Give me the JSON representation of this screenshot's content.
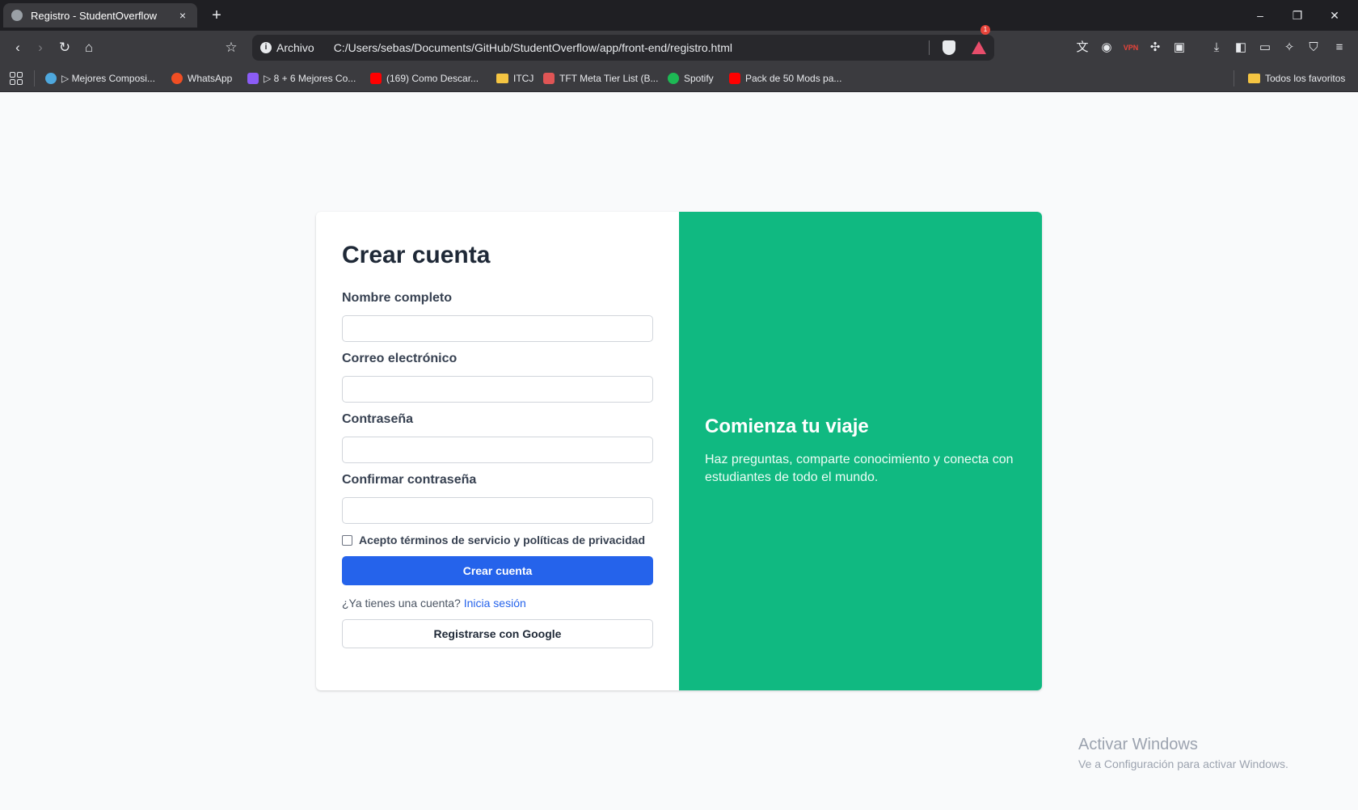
{
  "browser": {
    "tab_title": "Registro - StudentOverflow",
    "tab_close_icon": "×",
    "new_tab_icon": "+",
    "window_controls": {
      "minimize": "–",
      "restore": "❐",
      "close": "✕"
    },
    "address": {
      "label": "Archivo",
      "url": "C:/Users/sebas/Documents/GitHub/StudentOverflow/app/front-end/registro.html",
      "rewards_badge": "1"
    },
    "nav": {
      "back": "‹",
      "forward": "›",
      "reload": "↻",
      "home": "⌂",
      "bookmark": "☆"
    },
    "extensions": [
      "translate-icon",
      "chrome-icon",
      "vpn-icon",
      "puzzle-icon",
      "screenshot-icon",
      "download-icon",
      "sidebar-icon",
      "wallet-icon",
      "leo-icon",
      "vpn-shield-icon",
      "menu-icon"
    ],
    "bookmarks": [
      {
        "label": "▷ Mejores Composi...",
        "color": "#4ea8de"
      },
      {
        "label": "WhatsApp",
        "color": "#f04e23"
      },
      {
        "label": "▷ 8 + 6 Mejores Co...",
        "color": "#8b5cf6"
      },
      {
        "label": "(169) Como Descar...",
        "color": "#ff0000"
      },
      {
        "label": "ITCJ",
        "color": "#f5c542"
      },
      {
        "label": "TFT Meta Tier List (B...",
        "color": "#e05555"
      },
      {
        "label": "Spotify",
        "color": "#1db954"
      },
      {
        "label": "Pack de 50 Mods pa...",
        "color": "#ff0000"
      }
    ],
    "all_bookmarks": "Todos los favoritos"
  },
  "page": {
    "form": {
      "title": "Crear cuenta",
      "name_label": "Nombre completo",
      "email_label": "Correo electrónico",
      "password_label": "Contraseña",
      "confirm_label": "Confirmar contraseña",
      "terms_label": "Acepto términos de servicio y políticas de privacidad",
      "submit_label": "Crear cuenta",
      "login_prompt": "¿Ya tienes una cuenta?",
      "login_link": "Inicia sesión",
      "google_label": "Registrarse con Google"
    },
    "promo": {
      "title": "Comienza tu viaje",
      "text": "Haz preguntas, comparte conocimiento y conecta con estudiantes de todo el mundo."
    }
  },
  "watermark": {
    "title": "Activar Windows",
    "subtitle": "Ve a Configuración para activar Windows."
  },
  "colors": {
    "primary": "#2563eb",
    "promo_bg": "#10b981",
    "browser_bg": "#3b3b3f"
  }
}
